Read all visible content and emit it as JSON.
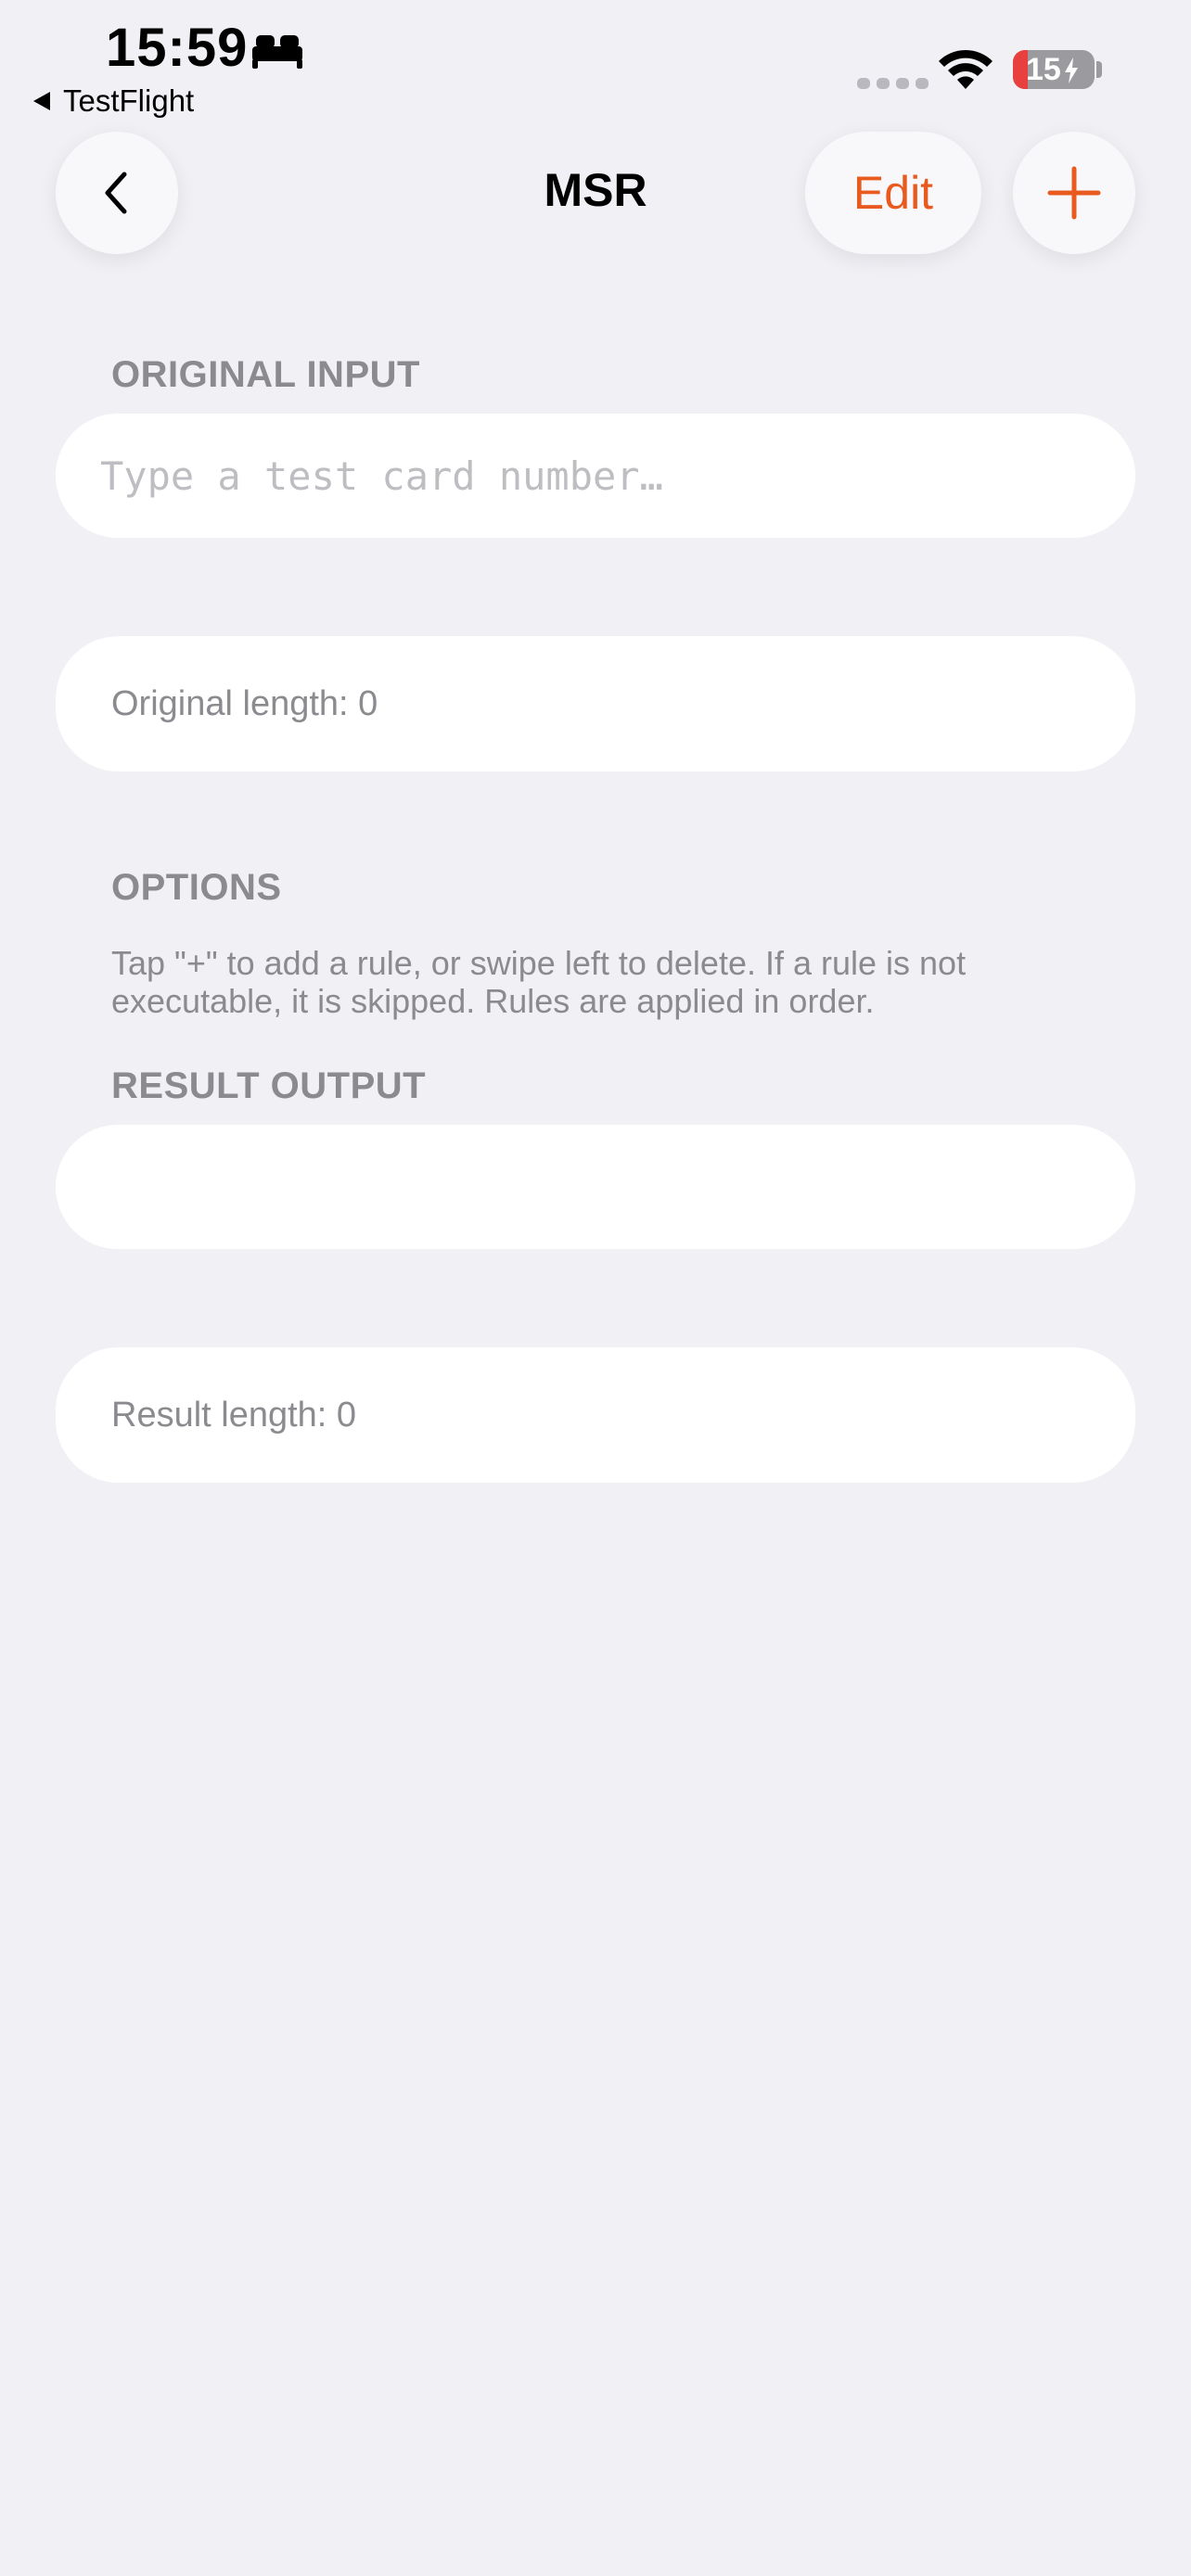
{
  "status_bar": {
    "time": "15:59",
    "focus_icon": "bed-icon",
    "back_app": "TestFlight",
    "battery_level": "15",
    "battery_color": "#E8403E"
  },
  "nav": {
    "title": "MSR",
    "edit_label": "Edit",
    "accent_color": "#E85A1E"
  },
  "original_input": {
    "header": "ORIGINAL INPUT",
    "value": "",
    "placeholder": "Type a test card number…",
    "length_label": "Original length: 0"
  },
  "options": {
    "header": "OPTIONS",
    "description": "Tap \"+\" to add a rule, or swipe left to delete. If a rule is not executable, it is skipped. Rules are applied in order."
  },
  "result_output": {
    "header": "RESULT OUTPUT",
    "value": "",
    "length_label": "Result length: 0"
  }
}
